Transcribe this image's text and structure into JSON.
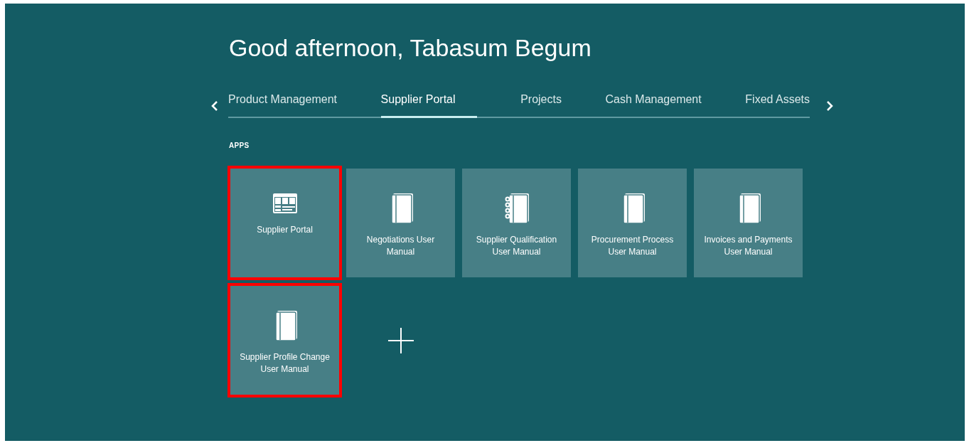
{
  "greeting": "Good afternoon, Tabasum Begum",
  "tabs": [
    {
      "label": "Product Management",
      "selected": false
    },
    {
      "label": "Supplier Portal",
      "selected": true
    },
    {
      "label": "Projects",
      "selected": false
    },
    {
      "label": "Cash Management",
      "selected": false
    },
    {
      "label": "Fixed Assets",
      "selected": false
    }
  ],
  "section_label": "APPS",
  "apps": [
    {
      "label": "Supplier Portal",
      "kind": "portal",
      "highlighted": true
    },
    {
      "label": "Negotiations User Manual",
      "kind": "book",
      "highlighted": false
    },
    {
      "label": "Supplier Qualification User Manual",
      "kind": "notebook",
      "highlighted": false
    },
    {
      "label": "Procurement Process User Manual",
      "kind": "book",
      "highlighted": false
    },
    {
      "label": "Invoices and Payments User Manual",
      "kind": "book",
      "highlighted": false
    },
    {
      "label": "Supplier Profile Change User Manual",
      "kind": "book",
      "highlighted": true
    }
  ]
}
